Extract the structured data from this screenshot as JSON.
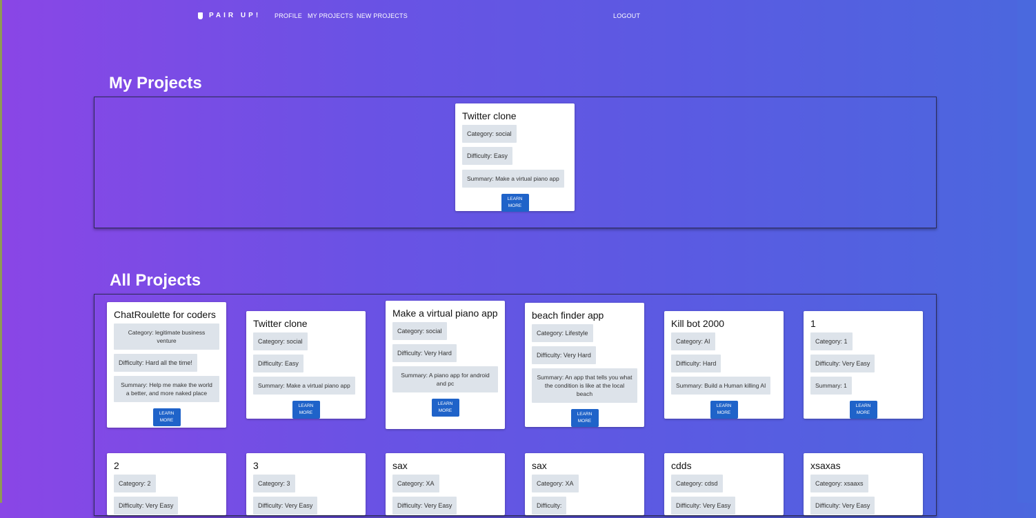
{
  "nav": {
    "brand": "PAIR UP!",
    "links": [
      "PROFILE",
      "MY PROJECTS",
      "NEW PROJECTS"
    ],
    "logout": "LOGOUT"
  },
  "my_projects": {
    "title": "My Projects",
    "cards": [
      {
        "title": "Twitter clone",
        "category": "Category: social",
        "difficulty": "Difficulty: Easy",
        "summary": "Summary: Make a virtual piano app",
        "button": "LEARN MORE"
      }
    ]
  },
  "all_projects": {
    "title": "All Projects",
    "cards": [
      {
        "title": "ChatRoulette for coders",
        "category": "Category: legitimate business venture",
        "difficulty": "Difficulty: Hard all the time!",
        "summary": "Summary: Help me make the world a better, and more naked place",
        "button": "LEARN MORE"
      },
      {
        "title": "Twitter clone",
        "category": "Category: social",
        "difficulty": "Difficulty: Easy",
        "summary": "Summary: Make a virtual piano app",
        "button": "LEARN MORE"
      },
      {
        "title": "Make a virtual piano app",
        "category": "Category: social",
        "difficulty": "Difficulty: Very Hard",
        "summary": "Summary: A piano app for android and pc",
        "button": "LEARN MORE"
      },
      {
        "title": "beach finder app",
        "category": "Category: Lifestyle",
        "difficulty": "Difficulty: Very Hard",
        "summary": "Summary: An app that tells you what the condition is like at the local beach",
        "button": "LEARN MORE"
      },
      {
        "title": "Kill bot 2000",
        "category": "Category: AI",
        "difficulty": "Difficulty: Hard",
        "summary": "Summary: Build a Human killing AI",
        "button": "LEARN MORE"
      },
      {
        "title": "1",
        "category": "Category: 1",
        "difficulty": "Difficulty: Very Easy",
        "summary": "Summary: 1",
        "button": "LEARN MORE"
      },
      {
        "title": "2",
        "category": "Category: 2",
        "difficulty": "Difficulty: Very Easy"
      },
      {
        "title": "3",
        "category": "Category: 3",
        "difficulty": "Difficulty: Very Easy"
      },
      {
        "title": "sax",
        "category": "Category: XA",
        "difficulty": "Difficulty: Very Easy"
      },
      {
        "title": "sax",
        "category": "Category: XA",
        "difficulty": "Difficulty:"
      },
      {
        "title": "cdds",
        "category": "Category: cdsd",
        "difficulty": "Difficulty: Very Easy"
      },
      {
        "title": "xsaxas",
        "category": "Category: xsaaxs",
        "difficulty": "Difficulty: Very Easy"
      }
    ]
  }
}
